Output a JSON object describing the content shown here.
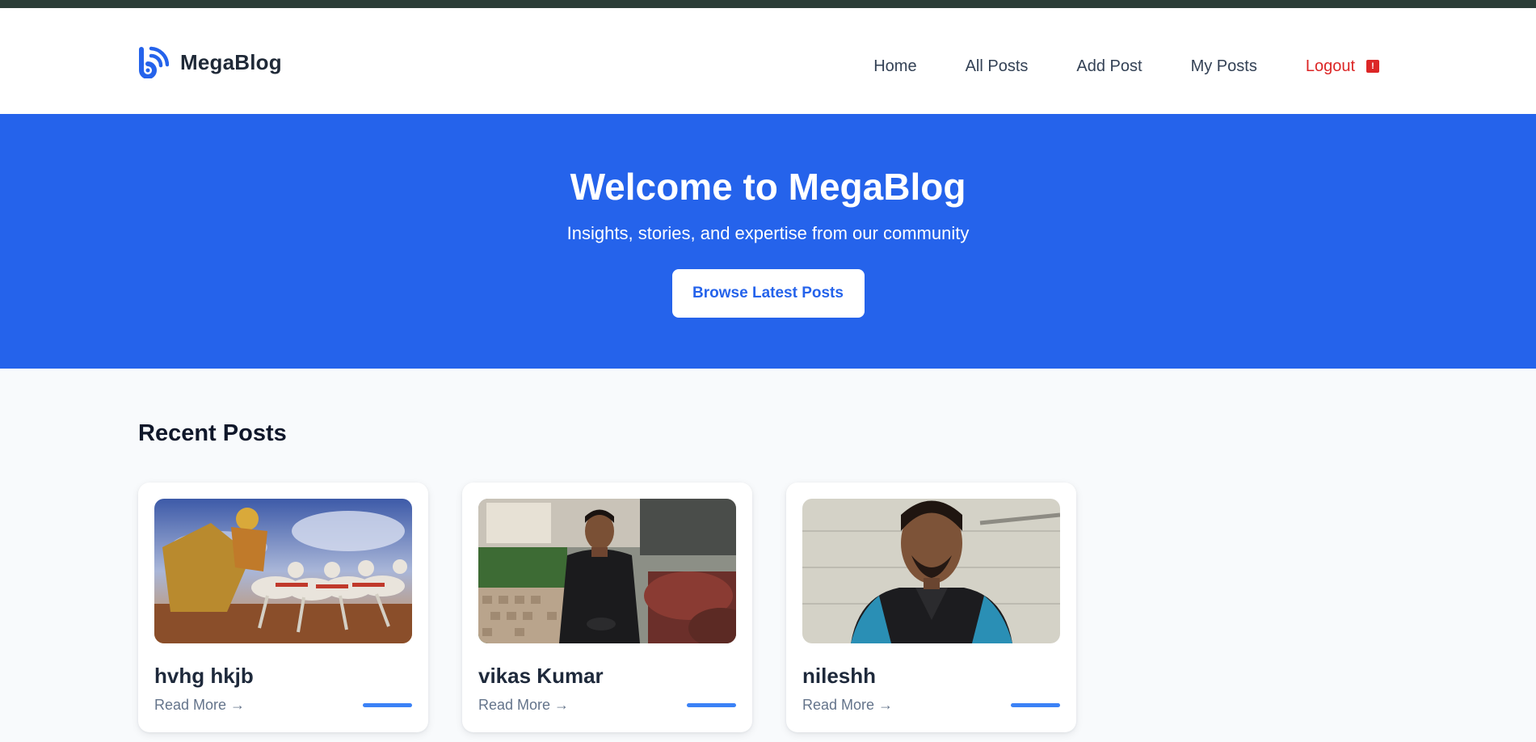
{
  "app": {
    "brand_name": "MegaBlog",
    "logo_icon": "blog-logo-icon",
    "accent_color": "#2563eb"
  },
  "nav": {
    "items": [
      {
        "label": "Home"
      },
      {
        "label": "All Posts"
      },
      {
        "label": "Add Post"
      },
      {
        "label": "My Posts"
      }
    ],
    "logout": {
      "label": "Logout",
      "icon": "logout-icon",
      "color": "#dc2626"
    }
  },
  "hero": {
    "title": "Welcome to MegaBlog",
    "subtitle": "Insights, stories, and expertise from our community",
    "button_label": "Browse Latest Posts",
    "background": "#2563eb"
  },
  "recent": {
    "heading": "Recent Posts",
    "posts": [
      {
        "title": "hvhg hkjb",
        "read_more": "Read More →"
      },
      {
        "title": "vikas Kumar",
        "read_more": "Read More →"
      },
      {
        "title": "nileshh",
        "read_more": "Read More →"
      }
    ]
  }
}
